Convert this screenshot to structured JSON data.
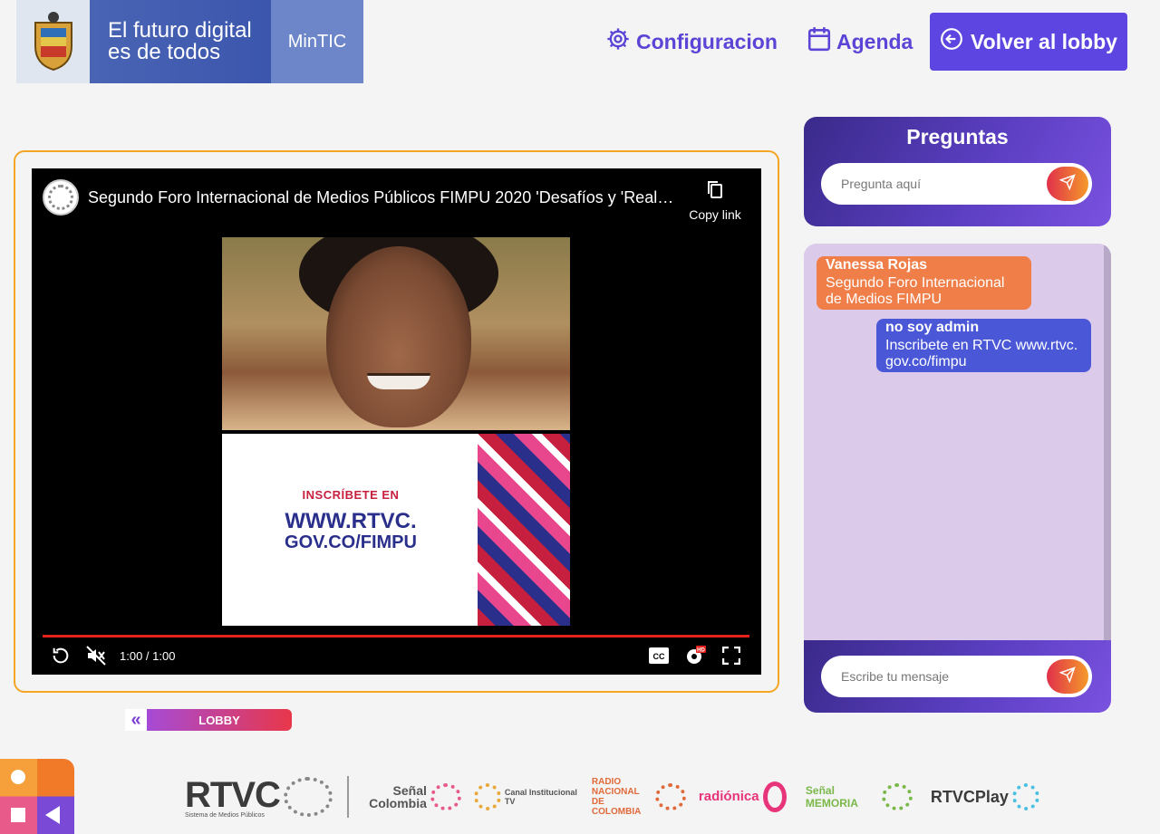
{
  "brand": {
    "tagline_line1": "El futuro digital",
    "tagline_line2": "es de todos",
    "ministry": "MinTIC"
  },
  "nav": {
    "config_label": "Configuracion",
    "agenda_label": "Agenda",
    "lobby_label": "Volver al lobby",
    "accent": "#5c45e0"
  },
  "video": {
    "title": "Segundo Foro Internacional de Medios Públicos FIMPU 2020 'Desafíos y 'Realid…",
    "copy_link_label": "Copy link",
    "time_label": "1:00 / 1:00",
    "progress": 1.0,
    "promo_small": "INSCRÍBETE EN",
    "promo_url_line1": "WWW.RTVC.",
    "promo_url_line2": "GOV.CO/FIMPU"
  },
  "lobby_mini": {
    "label": "LOBBY"
  },
  "questions": {
    "title": "Preguntas",
    "placeholder": "Pregunta aquí"
  },
  "chat": {
    "messages": [
      {
        "author": "Vanessa Rojas",
        "text": "Segundo Foro Internacional de Medios FIMPU"
      },
      {
        "author": "no soy admin",
        "text": "Inscribete en RTVC www.rtvc. gov.co/fimpu"
      }
    ],
    "placeholder": "Escribe tu mensaje"
  },
  "footer": {
    "rtvc": "RTVC",
    "rtvc_sub": "Sistema de Medios Públicos",
    "senal_colombia": "Señal Colombia",
    "canal_institucional": "Canal Institucional TV",
    "radio_nacional": "RADIO NACIONAL DE COLOMBIA",
    "radionica": "radiónica",
    "senal_memoria": "Señal MEMORIA",
    "rtvc_play": "RTVCPlay"
  }
}
